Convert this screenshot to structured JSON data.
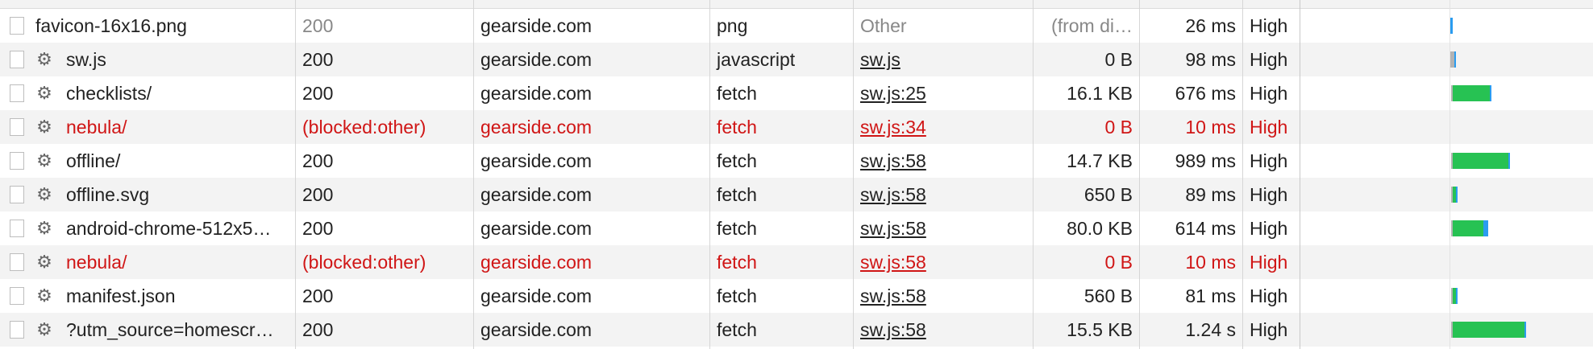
{
  "rows": [
    {
      "name": "favicon-16x16.png",
      "gear": false,
      "status": "200",
      "status_muted": true,
      "domain": "gearside.com",
      "type": "png",
      "initiator": "Other",
      "initiator_link": false,
      "initiator_muted": true,
      "size": "(from di…",
      "size_muted": true,
      "time": "26 ms",
      "priority": "High",
      "blocked": false,
      "waterfall": {
        "start": 0.51,
        "queue": 0.0,
        "wait": 0.0,
        "recv": 0.012
      }
    },
    {
      "name": "sw.js",
      "gear": true,
      "status": "200",
      "status_muted": false,
      "domain": "gearside.com",
      "type": "javascript",
      "initiator": "sw.js",
      "initiator_link": true,
      "initiator_muted": false,
      "size": "0 B",
      "size_muted": false,
      "time": "98 ms",
      "priority": "High",
      "blocked": false,
      "waterfall": {
        "start": 0.51,
        "queue": 0.015,
        "wait": 0.0,
        "recv": 0.006
      }
    },
    {
      "name": "checklists/",
      "gear": true,
      "status": "200",
      "status_muted": false,
      "domain": "gearside.com",
      "type": "fetch",
      "initiator": "sw.js:25",
      "initiator_link": true,
      "initiator_muted": false,
      "size": "16.1 KB",
      "size_muted": false,
      "time": "676 ms",
      "priority": "High",
      "blocked": false,
      "waterfall": {
        "start": 0.515,
        "queue": 0.005,
        "wait": 0.128,
        "recv": 0.006
      }
    },
    {
      "name": "nebula/",
      "gear": true,
      "status": "(blocked:other)",
      "status_muted": false,
      "domain": "gearside.com",
      "type": "fetch",
      "initiator": "sw.js:34",
      "initiator_link": true,
      "initiator_muted": false,
      "size": "0 B",
      "size_muted": false,
      "time": "10 ms",
      "priority": "High",
      "blocked": true,
      "waterfall": null
    },
    {
      "name": "offline/",
      "gear": true,
      "status": "200",
      "status_muted": false,
      "domain": "gearside.com",
      "type": "fetch",
      "initiator": "sw.js:58",
      "initiator_link": true,
      "initiator_muted": false,
      "size": "14.7 KB",
      "size_muted": false,
      "time": "989 ms",
      "priority": "High",
      "blocked": false,
      "waterfall": {
        "start": 0.515,
        "queue": 0.005,
        "wait": 0.19,
        "recv": 0.006
      }
    },
    {
      "name": "offline.svg",
      "gear": true,
      "status": "200",
      "status_muted": false,
      "domain": "gearside.com",
      "type": "fetch",
      "initiator": "sw.js:58",
      "initiator_link": true,
      "initiator_muted": false,
      "size": "650 B",
      "size_muted": false,
      "time": "89 ms",
      "priority": "High",
      "blocked": false,
      "waterfall": {
        "start": 0.515,
        "queue": 0.005,
        "wait": 0.012,
        "recv": 0.003
      }
    },
    {
      "name": "android-chrome-512x5…",
      "gear": true,
      "status": "200",
      "status_muted": false,
      "domain": "gearside.com",
      "type": "fetch",
      "initiator": "sw.js:58",
      "initiator_link": true,
      "initiator_muted": false,
      "size": "80.0 KB",
      "size_muted": false,
      "time": "614 ms",
      "priority": "High",
      "blocked": false,
      "waterfall": {
        "start": 0.515,
        "queue": 0.005,
        "wait": 0.105,
        "recv": 0.016
      }
    },
    {
      "name": "nebula/",
      "gear": true,
      "status": "(blocked:other)",
      "status_muted": false,
      "domain": "gearside.com",
      "type": "fetch",
      "initiator": "sw.js:58",
      "initiator_link": true,
      "initiator_muted": false,
      "size": "0 B",
      "size_muted": false,
      "time": "10 ms",
      "priority": "High",
      "blocked": true,
      "waterfall": null
    },
    {
      "name": "manifest.json",
      "gear": true,
      "status": "200",
      "status_muted": false,
      "domain": "gearside.com",
      "type": "fetch",
      "initiator": "sw.js:58",
      "initiator_link": true,
      "initiator_muted": false,
      "size": "560 B",
      "size_muted": false,
      "time": "81 ms",
      "priority": "High",
      "blocked": false,
      "waterfall": {
        "start": 0.515,
        "queue": 0.005,
        "wait": 0.012,
        "recv": 0.003
      }
    },
    {
      "name": "?utm_source=homescr…",
      "gear": true,
      "status": "200",
      "status_muted": false,
      "domain": "gearside.com",
      "type": "fetch",
      "initiator": "sw.js:58",
      "initiator_link": true,
      "initiator_muted": false,
      "size": "15.5 KB",
      "size_muted": false,
      "time": "1.24 s",
      "priority": "High",
      "blocked": false,
      "waterfall": {
        "start": 0.515,
        "queue": 0.005,
        "wait": 0.245,
        "recv": 0.006
      }
    }
  ],
  "icons": {
    "gear": "gear-icon",
    "checkbox": "checkbox-icon"
  },
  "colors": {
    "blocked_text": "#d01515",
    "waiting": "#27c253",
    "receiving": "#2a9cf0",
    "queueing": "#b3b3b3"
  }
}
